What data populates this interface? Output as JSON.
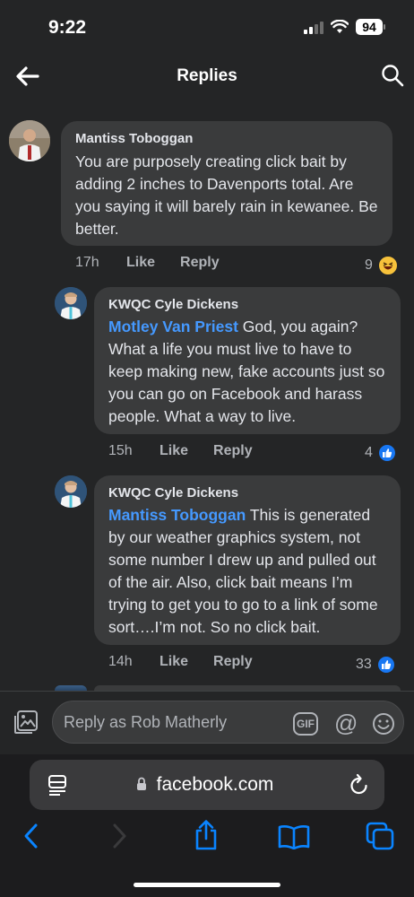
{
  "status_bar": {
    "time": "9:22",
    "battery": "94"
  },
  "header": {
    "title": "Replies",
    "back_icon": "arrow-left-icon",
    "search_icon": "search-icon"
  },
  "comments": [
    {
      "author": "Mantiss Toboggan",
      "mention": "",
      "text": "You are purposely creating click bait by adding 2 inches to Davenports total. Are you saying it will barely rain in kewanee. Be better.",
      "time": "17h",
      "like_label": "Like",
      "reply_label": "Reply",
      "reaction_count": "9",
      "reaction_type": "haha-icon"
    },
    {
      "author": "KWQC Cyle Dickens",
      "mention": "Motley Van Priest",
      "text": " God, you again? What a life you must live to have to keep making new, fake accounts just so you can go on Facebook and harass people. What a way to live.",
      "time": "15h",
      "like_label": "Like",
      "reply_label": "Reply",
      "reaction_count": "4",
      "reaction_type": "like-icon"
    },
    {
      "author": "KWQC Cyle Dickens",
      "mention": "Mantiss Toboggan",
      "text": " This is generated by our weather graphics system, not some number I drew up and pulled out of the air. Also, click bait means I’m trying to get you to go to a link of some sort….I’m not. So no click bait.",
      "time": "14h",
      "like_label": "Like",
      "reply_label": "Reply",
      "reaction_count": "33",
      "reaction_type": "like-icon"
    }
  ],
  "composer": {
    "placeholder": "Reply as Rob Matherly",
    "gif_label": "GIF",
    "at_label": "@"
  },
  "browser": {
    "url": "facebook.com"
  },
  "colors": {
    "background": "#242526",
    "bubble": "#3a3b3c",
    "mention": "#4599ff",
    "like": "#1877f2",
    "safari_blue": "#0a84ff"
  }
}
